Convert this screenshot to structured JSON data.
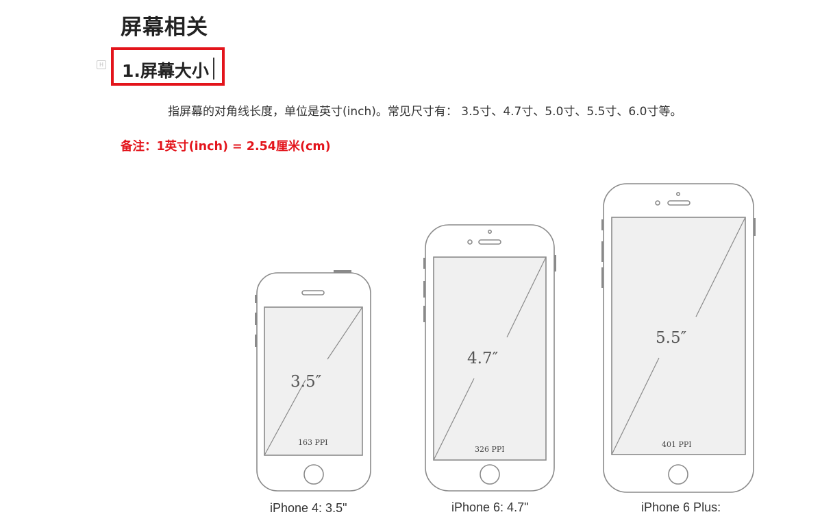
{
  "heading": "屏幕相关",
  "section": {
    "title": "1.屏幕大小",
    "description": "指屏幕的对角线长度，单位是英寸(inch)。常见尺寸有： 3.5寸、4.7寸、5.0寸、5.5寸、6.0寸等。",
    "note": "备注：1英寸(inch) = 2.54厘米(cm)"
  },
  "phones": [
    {
      "size": "3.5″",
      "ppi": "163 PPI",
      "caption": "iPhone 4: 3.5\""
    },
    {
      "size": "4.7″",
      "ppi": "326 PPI",
      "caption": "iPhone 6: 4.7\""
    },
    {
      "size": "5.5″",
      "ppi": "401 PPI",
      "caption": "iPhone 6 Plus:"
    }
  ],
  "colors": {
    "highlight_border": "#e3141b",
    "note_text": "#e3141b",
    "phone_outline": "#8a8a8a",
    "screen_fill": "#f0f0f0"
  }
}
